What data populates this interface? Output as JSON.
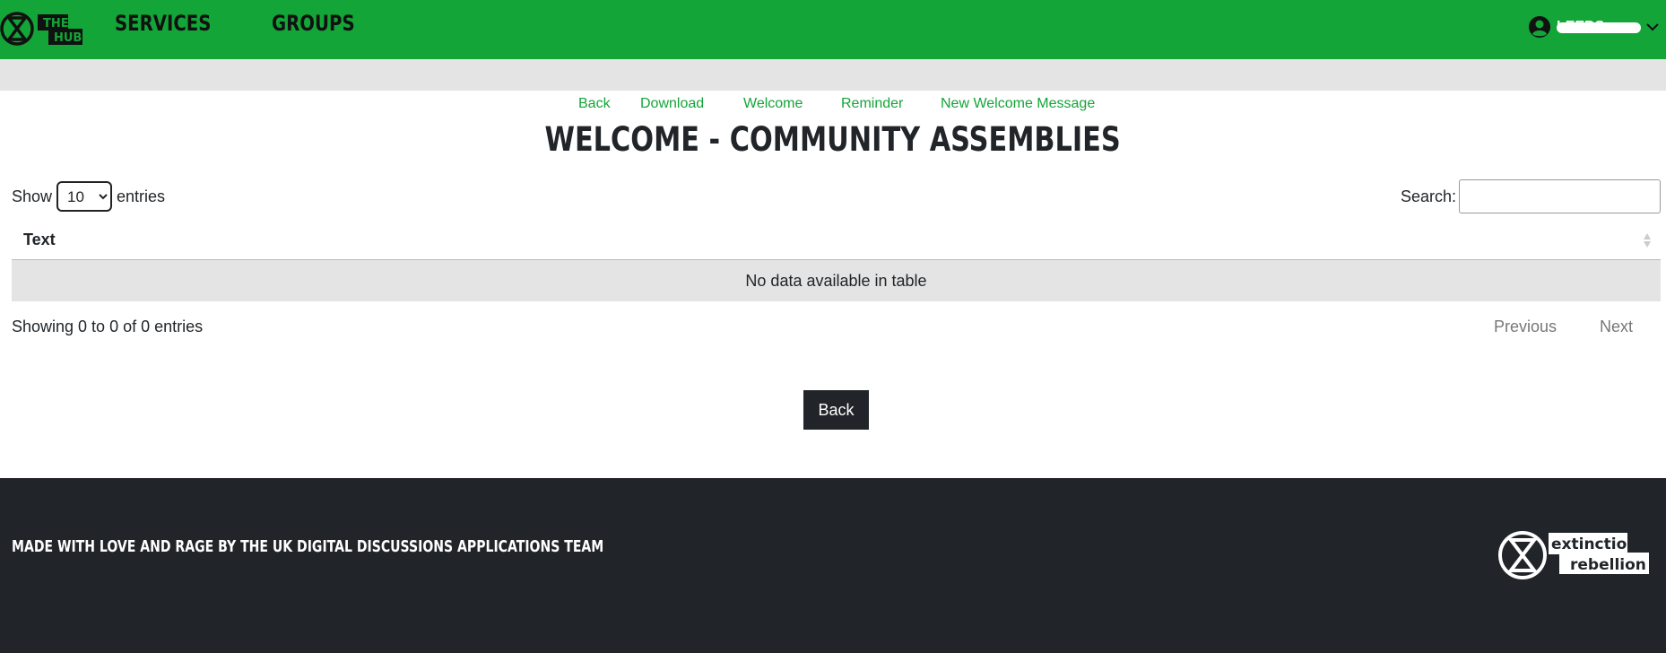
{
  "header": {
    "logo_text": [
      "THE",
      "HUB"
    ],
    "nav": {
      "services": "SERVICES",
      "groups": "GROUPS"
    },
    "user_name": "LEEDS",
    "colors": {
      "brand_green": "#13a538",
      "dark": "#212529"
    }
  },
  "actions": {
    "back": "Back",
    "download": "Download",
    "welcome": "Welcome",
    "reminder": "Reminder",
    "new_welcome_message": "New Welcome Message"
  },
  "page": {
    "title": "WELCOME - COMMUNITY ASSEMBLIES"
  },
  "table_controls": {
    "show_label": "Show",
    "entries_label": "entries",
    "page_length": "10",
    "page_length_options": [
      "10"
    ],
    "search_label": "Search:",
    "search_value": ""
  },
  "table": {
    "columns": [
      "Text"
    ],
    "empty_message": "No data available in table",
    "info": "Showing 0 to 0 of 0 entries",
    "pagination": {
      "previous": "Previous",
      "next": "Next"
    }
  },
  "back_button": "Back",
  "footer": {
    "credit": "MADE WITH LOVE AND RAGE BY THE UK DIGITAL DISCUSSIONS APPLICATIONS TEAM",
    "logo_text": [
      "extinction",
      "rebellion"
    ]
  }
}
